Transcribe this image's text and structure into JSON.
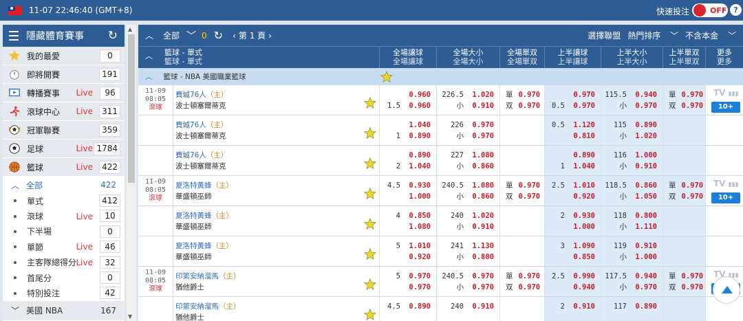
{
  "topbar": {
    "datetime": "11-07 22:46:40 (GMT+8)",
    "quick_bet_label": "快速投注",
    "toggle_label": "OFF",
    "help_label": "?"
  },
  "sidebar": {
    "title": "隱藏體育賽事",
    "sports": [
      {
        "label": "我的最愛",
        "live": "",
        "count": "0",
        "icon": "star-icon"
      },
      {
        "label": "即將開賽",
        "live": "",
        "count": "191",
        "icon": "stopwatch-icon"
      },
      {
        "label": "轉播賽事",
        "live": "Live",
        "count": "96",
        "icon": "tv-icon"
      },
      {
        "label": "滾球中心",
        "live": "Live",
        "count": "311",
        "icon": "runner-icon"
      },
      {
        "label": "冠軍聯賽",
        "live": "",
        "count": "359",
        "icon": "trophy-ball-icon"
      },
      {
        "label": "足球",
        "live": "Live",
        "count": "1784",
        "icon": "soccer-ball-icon"
      },
      {
        "label": "籃球",
        "live": "Live",
        "count": "422",
        "icon": "basketball-icon"
      }
    ],
    "sub_all": {
      "label": "全部",
      "count": "422"
    },
    "subs": [
      {
        "label": "單式",
        "live": "",
        "count": "412"
      },
      {
        "label": "滾球",
        "live": "Live",
        "count": "10"
      },
      {
        "label": "下半場",
        "live": "",
        "count": "0"
      },
      {
        "label": "單節",
        "live": "Live",
        "count": "46"
      },
      {
        "label": "主客隊總得分",
        "live": "Live",
        "count": "32"
      },
      {
        "label": "首尾分",
        "live": "",
        "count": "0"
      },
      {
        "label": "特別投注",
        "live": "",
        "count": "42"
      }
    ],
    "league": {
      "label": "美國 NBA",
      "count": "167"
    }
  },
  "toolbar": {
    "all_label": "全部",
    "count": "0",
    "page_label": "第 1 頁",
    "select_league": "選擇聯盟",
    "hot_sort": "熱門排序",
    "currency": "不含本金"
  },
  "table": {
    "headers": [
      "籃球 - 單式",
      "全場讓球",
      "全場大小",
      "全場單双",
      "上半讓球",
      "上半大小",
      "上半單双",
      "更多"
    ],
    "league_title": "籃球 - NBA 美國職業籃球",
    "rows": [
      {
        "time": "11-09",
        "time2": "08:05",
        "status": "滾球",
        "home": "費城76人",
        "tag": "（主）",
        "away": "波士頓塞爾蒂克",
        "fh": [
          "",
          "1.5"
        ],
        "fhv": [
          "0.960",
          "0.960"
        ],
        "fo": [
          "226.5",
          "小"
        ],
        "fov": [
          "1.020",
          "0.910"
        ],
        "oe": [
          "單",
          "双"
        ],
        "oev": [
          "0.970",
          "0.970"
        ],
        "hh": [
          "",
          "0.5"
        ],
        "hhv": [
          "0.970",
          "0.970"
        ],
        "ho": [
          "115.5",
          "小"
        ],
        "hov": [
          "0.940",
          "0.970"
        ],
        "hoe": [
          "單",
          "双"
        ],
        "hoev": [
          "0.970",
          "0.970"
        ],
        "tv": "TV",
        "more": "10+"
      },
      {
        "time": "",
        "time2": "",
        "status": "",
        "home": "費城76人",
        "tag": "（主）",
        "away": "波士頓塞爾蒂克",
        "fh": [
          "",
          "1"
        ],
        "fhv": [
          "1.040",
          "0.890"
        ],
        "fo": [
          "226",
          "小"
        ],
        "fov": [
          "0.970",
          "0.970"
        ],
        "oe": [
          "",
          ""
        ],
        "oev": [
          "",
          ""
        ],
        "hh": [
          "0.5",
          ""
        ],
        "hhv": [
          "1.120",
          "0.810"
        ],
        "ho": [
          "115",
          "小"
        ],
        "hov": [
          "0.890",
          "1.020"
        ],
        "hoe": [
          "",
          ""
        ],
        "hoev": [
          "",
          ""
        ],
        "tv": "",
        "more": ""
      },
      {
        "time": "",
        "time2": "",
        "status": "",
        "home": "費城76人",
        "tag": "（主）",
        "away": "波士頓塞爾蒂克",
        "fh": [
          "",
          "2"
        ],
        "fhv": [
          "0.890",
          "1.040"
        ],
        "fo": [
          "227",
          "小"
        ],
        "fov": [
          "1.080",
          "0.860"
        ],
        "oe": [
          "",
          ""
        ],
        "oev": [
          "",
          ""
        ],
        "hh": [
          "",
          "1"
        ],
        "hhv": [
          "0.890",
          "1.040"
        ],
        "ho": [
          "116",
          "小"
        ],
        "hov": [
          "1.000",
          "0.910"
        ],
        "hoe": [
          "",
          ""
        ],
        "hoev": [
          "",
          ""
        ],
        "tv": "",
        "more": ""
      },
      {
        "time": "11-09",
        "time2": "08:05",
        "status": "滾球",
        "home": "夏洛特黃蜂",
        "tag": "（主）",
        "away": "華盛頓巫師",
        "fh": [
          "4.5",
          ""
        ],
        "fhv": [
          "0.930",
          "1.000"
        ],
        "fo": [
          "240.5",
          "小"
        ],
        "fov": [
          "1.080",
          "0.860"
        ],
        "oe": [
          "單",
          "双"
        ],
        "oev": [
          "0.970",
          "0.970"
        ],
        "hh": [
          "2.5",
          ""
        ],
        "hhv": [
          "1.010",
          "0.920"
        ],
        "ho": [
          "118.5",
          "小"
        ],
        "hov": [
          "0.860",
          "1.050"
        ],
        "hoe": [
          "單",
          "双"
        ],
        "hoev": [
          "0.970",
          "0.970"
        ],
        "tv": "TV",
        "more": "10+"
      },
      {
        "time": "",
        "time2": "",
        "status": "",
        "home": "夏洛特黃蜂",
        "tag": "（主）",
        "away": "華盛頓巫師",
        "fh": [
          "4",
          ""
        ],
        "fhv": [
          "0.850",
          "1.080"
        ],
        "fo": [
          "240",
          "小"
        ],
        "fov": [
          "1.020",
          "0.910"
        ],
        "oe": [
          "",
          ""
        ],
        "oev": [
          "",
          ""
        ],
        "hh": [
          "2",
          ""
        ],
        "hhv": [
          "0.930",
          "1.000"
        ],
        "ho": [
          "118",
          "小"
        ],
        "hov": [
          "0.800",
          "1.110"
        ],
        "hoe": [
          "",
          ""
        ],
        "hoev": [
          "",
          ""
        ],
        "tv": "",
        "more": ""
      },
      {
        "time": "",
        "time2": "",
        "status": "",
        "home": "夏洛特黃蜂",
        "tag": "（主）",
        "away": "華盛頓巫師",
        "fh": [
          "5",
          ""
        ],
        "fhv": [
          "1.010",
          "0.920"
        ],
        "fo": [
          "241",
          "小"
        ],
        "fov": [
          "1.130",
          "0.800"
        ],
        "oe": [
          "",
          ""
        ],
        "oev": [
          "",
          ""
        ],
        "hh": [
          "3",
          ""
        ],
        "hhv": [
          "1.090",
          "0.850"
        ],
        "ho": [
          "119",
          "小"
        ],
        "hov": [
          "0.910",
          "1.000"
        ],
        "hoe": [
          "",
          ""
        ],
        "hoev": [
          "",
          ""
        ],
        "tv": "",
        "more": ""
      },
      {
        "time": "11-09",
        "time2": "08:05",
        "status": "滾球",
        "home": "印第安納溜馬",
        "tag": "（主）",
        "away": "猶他爵士",
        "fh": [
          "5",
          ""
        ],
        "fhv": [
          "0.970",
          "0.970"
        ],
        "fo": [
          "240.5",
          "小"
        ],
        "fov": [
          "0.970",
          "0.970"
        ],
        "oe": [
          "單",
          "双"
        ],
        "oev": [
          "0.970",
          "0.970"
        ],
        "hh": [
          "2.5",
          ""
        ],
        "hhv": [
          "0.990",
          "0.940"
        ],
        "ho": [
          "117.5",
          "小"
        ],
        "hov": [
          "0.940",
          "0.970"
        ],
        "hoe": [
          "單",
          "双"
        ],
        "hoev": [
          "0.970",
          "0.970"
        ],
        "tv": "TV",
        "more": "10+"
      },
      {
        "time": "",
        "time2": "",
        "status": "",
        "home": "印第安納溜馬",
        "tag": "（主）",
        "away": "猶他爵士",
        "fh": [
          "4.5",
          ""
        ],
        "fhv": [
          "0.890",
          ""
        ],
        "fo": [
          "240",
          ""
        ],
        "fov": [
          "0.910",
          ""
        ],
        "oe": [
          "",
          ""
        ],
        "oev": [
          "",
          ""
        ],
        "hh": [
          "2",
          ""
        ],
        "hhv": [
          "0.910",
          ""
        ],
        "ho": [
          "117",
          ""
        ],
        "hov": [
          "0.890",
          ""
        ],
        "hoe": [
          "",
          ""
        ],
        "hoev": [
          "",
          ""
        ],
        "tv": "",
        "more": ""
      }
    ]
  },
  "colors": {
    "brand": "#2e5c94",
    "live": "#e0383d",
    "odds": "#cc1f2a",
    "link": "#2e6fc0"
  }
}
